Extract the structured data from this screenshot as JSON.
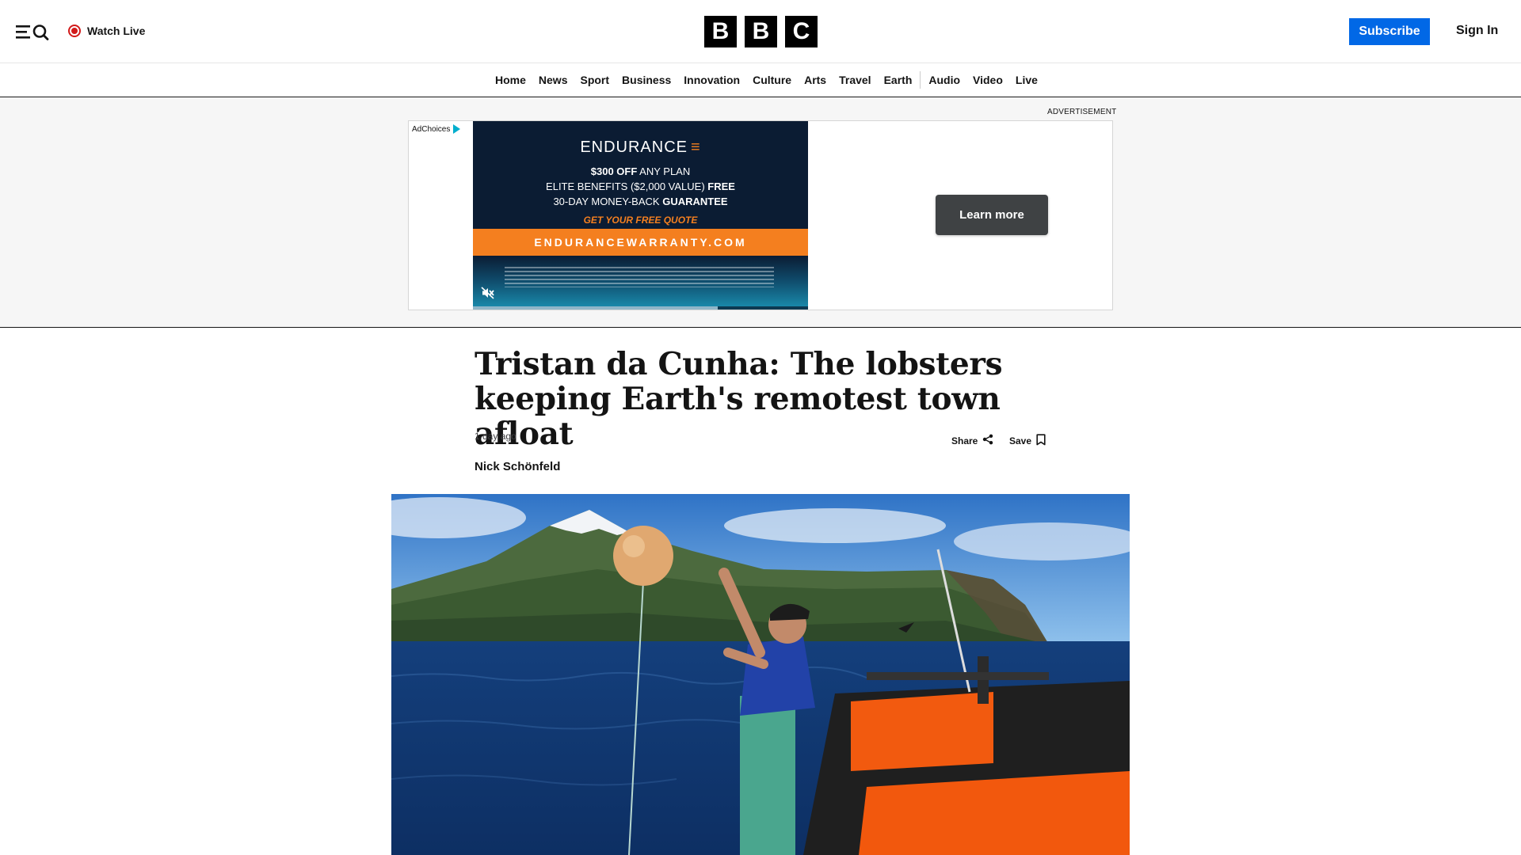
{
  "header": {
    "watch_live": "Watch Live",
    "logo_letters": [
      "B",
      "B",
      "C"
    ],
    "subscribe": "Subscribe",
    "sign_in": "Sign In",
    "icons": {
      "menu": "menu-search-icon",
      "live": "live-dot-icon"
    },
    "colors": {
      "subscribe_bg": "#0168e6",
      "live_red": "#d21a1a"
    }
  },
  "nav": {
    "items": [
      "Home",
      "News",
      "Sport",
      "Business",
      "Innovation",
      "Culture",
      "Arts",
      "Travel",
      "Earth",
      "Audio",
      "Video",
      "Live"
    ]
  },
  "ad": {
    "label": "ADVERTISEMENT",
    "adchoices": "AdChoices",
    "brand": "ENDURANCE",
    "offer_bold": "$300 OFF",
    "offer_rest": " ANY PLAN",
    "benefits_rest": "ELITE BENEFITS ($2,000 VALUE) ",
    "benefits_bold": "FREE",
    "guarantee_rest": "30-DAY MONEY-BACK ",
    "guarantee_bold": "GUARANTEE",
    "cta": "GET YOUR FREE QUOTE",
    "url": "ENDURANCEWARRANTY.COM",
    "learn_more": "Learn more",
    "video_progress": 0.73,
    "icons": {
      "adchoices": "adchoices-icon",
      "mute": "muted-speaker-icon"
    },
    "colors": {
      "accent": "#f47f1f",
      "navy": "#0b1c33",
      "button": "#3f4244"
    }
  },
  "article": {
    "headline": "Tristan da Cunha: The lobsters keeping Earth's remotest town afloat",
    "timestamp": "1 day ago",
    "share": "Share",
    "save": "Save",
    "byline": "Nick Schönfeld",
    "icons": {
      "share": "share-icon",
      "save": "bookmark-icon"
    }
  }
}
